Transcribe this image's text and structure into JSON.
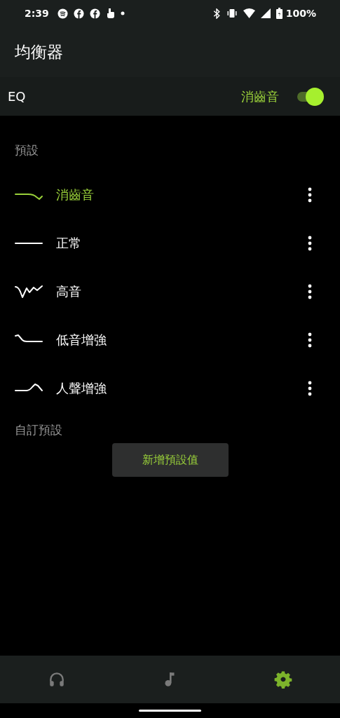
{
  "status_bar": {
    "time": "2:39",
    "battery": "100%"
  },
  "app_bar": {
    "title": "均衡器"
  },
  "eq_row": {
    "label": "EQ",
    "current_preset": "消齒音",
    "on": true
  },
  "presets_section": {
    "heading": "預設",
    "items": [
      {
        "label": "消齒音",
        "kind": "deesser",
        "selected": true
      },
      {
        "label": "正常",
        "kind": "flat",
        "selected": false
      },
      {
        "label": "高音",
        "kind": "treble",
        "selected": false
      },
      {
        "label": "低音增強",
        "kind": "bass",
        "selected": false
      },
      {
        "label": "人聲增強",
        "kind": "vocal",
        "selected": false
      }
    ]
  },
  "custom_section": {
    "heading": "自訂預設",
    "add_button": "新增預設值"
  },
  "bottom_nav": [
    {
      "kind": "headphones",
      "selected": false
    },
    {
      "kind": "music",
      "selected": false
    },
    {
      "kind": "settings",
      "selected": true
    }
  ]
}
